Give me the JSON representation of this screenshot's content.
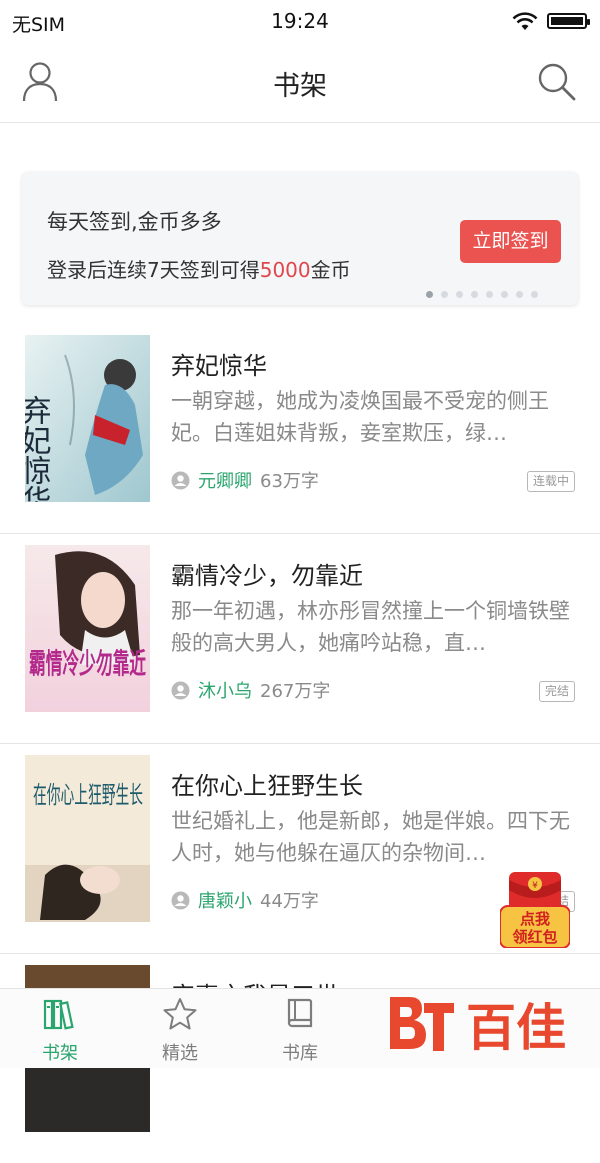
{
  "status_bar": {
    "carrier": "无SIM",
    "time": "19:24"
  },
  "header": {
    "title": "书架",
    "user_icon": "user-icon",
    "search_icon": "search-icon"
  },
  "signin_card": {
    "title": "每天签到,金币多多",
    "sub_prefix": "登录后连续7天签到可得",
    "sub_amount": "5000",
    "sub_suffix": "金币",
    "button_label": "立即签到",
    "carousel_pages": 8,
    "carousel_active": 1,
    "accent_color": "#eb5350"
  },
  "books": [
    {
      "title": "弃妃惊华",
      "description": "一朝穿越，她成为凌焕国最不受宠的侧王妃。白莲姐妹背叛，妾室欺压，绿…",
      "author": "元卿卿",
      "words": "63万字",
      "status": "连载中"
    },
    {
      "title": "霸情冷少，勿靠近",
      "description": "那一年初遇，林亦彤冒然撞上一个铜墙铁壁般的高大男人，她痛吟站稳，直…",
      "author": "沐小乌",
      "words": "267万字",
      "status": "完结"
    },
    {
      "title": "在你心上狂野生长",
      "description": "世纪婚礼上，他是新郎，她是伴娘。四下无人时，她与他躲在逼仄的杂物间…",
      "author": "唐颖小",
      "words": "44万字",
      "status": "完结"
    },
    {
      "title": "宠妻之我是三世",
      "description": "",
      "author": "",
      "words": "",
      "status": ""
    }
  ],
  "cover_text": {
    "book1_title": "弃妃惊华",
    "book2_title": "霸情冷少勿靠近",
    "book3_title": "在你心上狂野生长"
  },
  "red_packet": {
    "label_line1": "点我",
    "label_line2": "领红包"
  },
  "watermark": {
    "text": "百佳"
  },
  "tabs": [
    {
      "label": "书架",
      "icon": "bookshelf-icon",
      "active": true
    },
    {
      "label": "精选",
      "icon": "star-icon",
      "active": false
    },
    {
      "label": "书库",
      "icon": "book-icon",
      "active": false
    }
  ],
  "colors": {
    "green": "#2ba56e",
    "red": "#eb5350",
    "gray_text": "#8a8a8a"
  }
}
